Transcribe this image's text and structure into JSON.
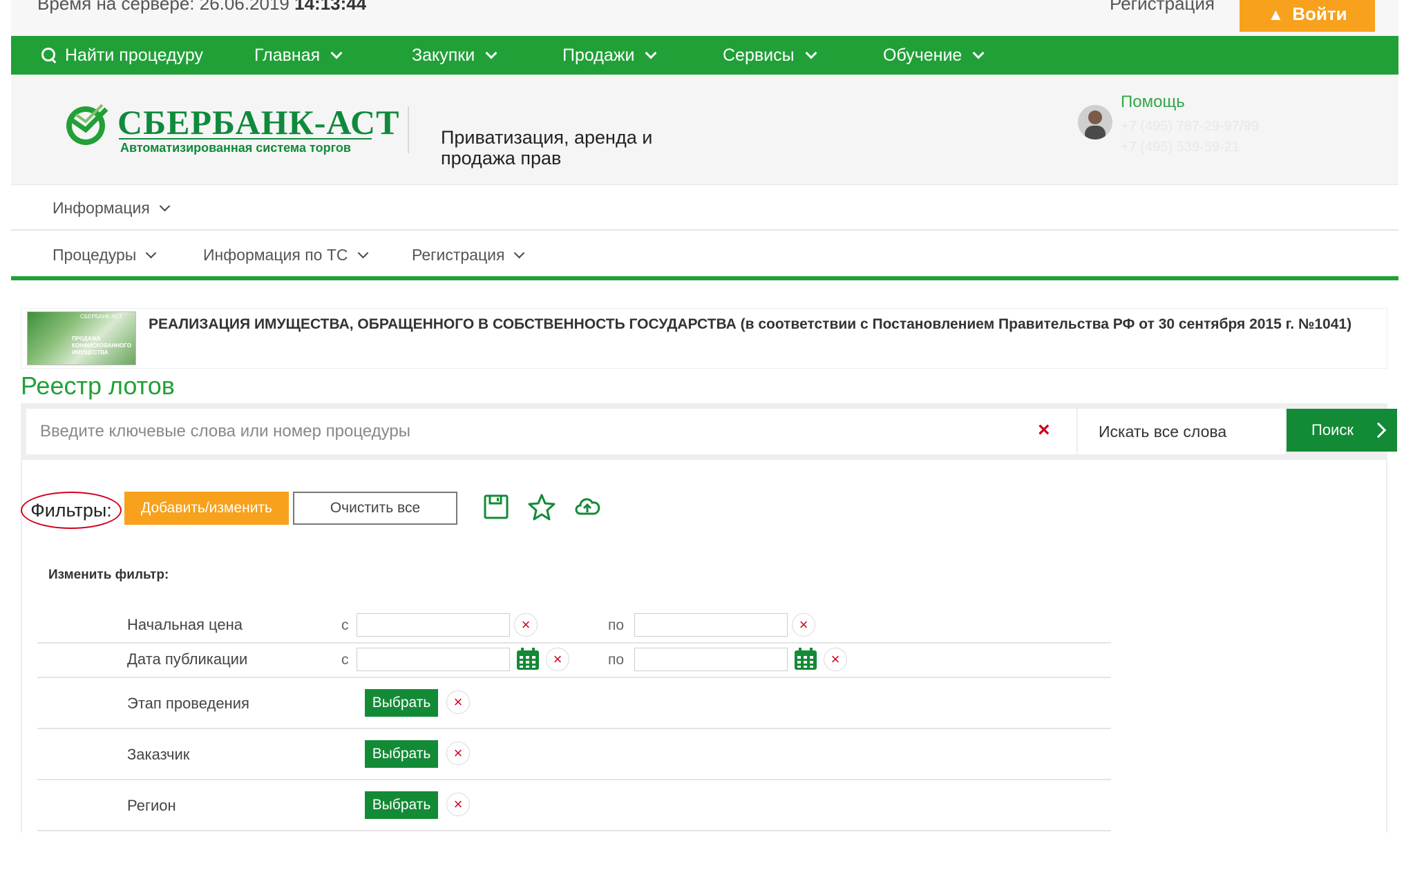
{
  "topbar": {
    "server_time_label": "Время на сервере: 26.06.2019",
    "server_time_value": "14:13:44",
    "register_link": "Регистрация",
    "login_button": "Войти"
  },
  "nav": {
    "items": [
      {
        "label": "Найти процедуру"
      },
      {
        "label": "Главная"
      },
      {
        "label": "Закупки"
      },
      {
        "label": "Продажи"
      },
      {
        "label": "Сервисы"
      },
      {
        "label": "Обучение"
      }
    ]
  },
  "header": {
    "logo_text": "СБЕРБАНК-АСТ",
    "logo_subtitle": "Автоматизированная система торгов",
    "section_title": "Приватизация, аренда и продажа прав",
    "help_link": "Помощь",
    "phone_1": "+7 (495) 787-29-97/99",
    "phone_2": "+7 (495) 539-59-21"
  },
  "menu_primary": {
    "items": [
      {
        "label": "Информация"
      }
    ]
  },
  "menu_secondary": {
    "items": [
      {
        "label": "Процедуры"
      },
      {
        "label": "Информация по ТС"
      },
      {
        "label": "Регистрация"
      }
    ]
  },
  "banner": {
    "image_caption_top": "СБЕРБАНК-АСТ",
    "image_caption": "ПРОДАЖА КОНФИСКОВАННОГО ИМУЩЕСТВА",
    "text": "РЕАЛИЗАЦИЯ ИМУЩЕСТВА, ОБРАЩЕННОГО В СОБСТВЕННОСТЬ ГОСУДАРСТВА (в соответствии с Постановлением Правительства РФ от 30 сентября 2015 г. №1041)"
  },
  "page_title": "Реестр лотов",
  "search": {
    "placeholder": "Введите ключевые слова или номер процедуры",
    "value": "",
    "clear_symbol": "×",
    "mode_label": "Искать все слова",
    "button_label": "Поиск"
  },
  "filters": {
    "label": "Фильтры:",
    "add_button": "Добавить/изменить",
    "clear_button": "Очистить все",
    "change_title": "Изменить фильтр:",
    "from_prefix": "с",
    "to_prefix": "по",
    "choose_label": "Выбрать",
    "remove_symbol": "×",
    "rows": [
      {
        "label": "Начальная цена"
      },
      {
        "label": "Дата публикации"
      },
      {
        "label": "Этап проведения"
      },
      {
        "label": "Заказчик"
      },
      {
        "label": "Регион"
      }
    ]
  },
  "colors": {
    "brand_green": "#21a038",
    "button_green": "#138a36",
    "accent_orange": "#f7a11c",
    "alert_red": "#d0021b"
  },
  "icons": {
    "nav_search": "search-icon",
    "save": "save-icon",
    "favorite": "star-icon",
    "export": "cloud-upload-icon",
    "calendar": "calendar-icon",
    "user": "user-icon"
  }
}
